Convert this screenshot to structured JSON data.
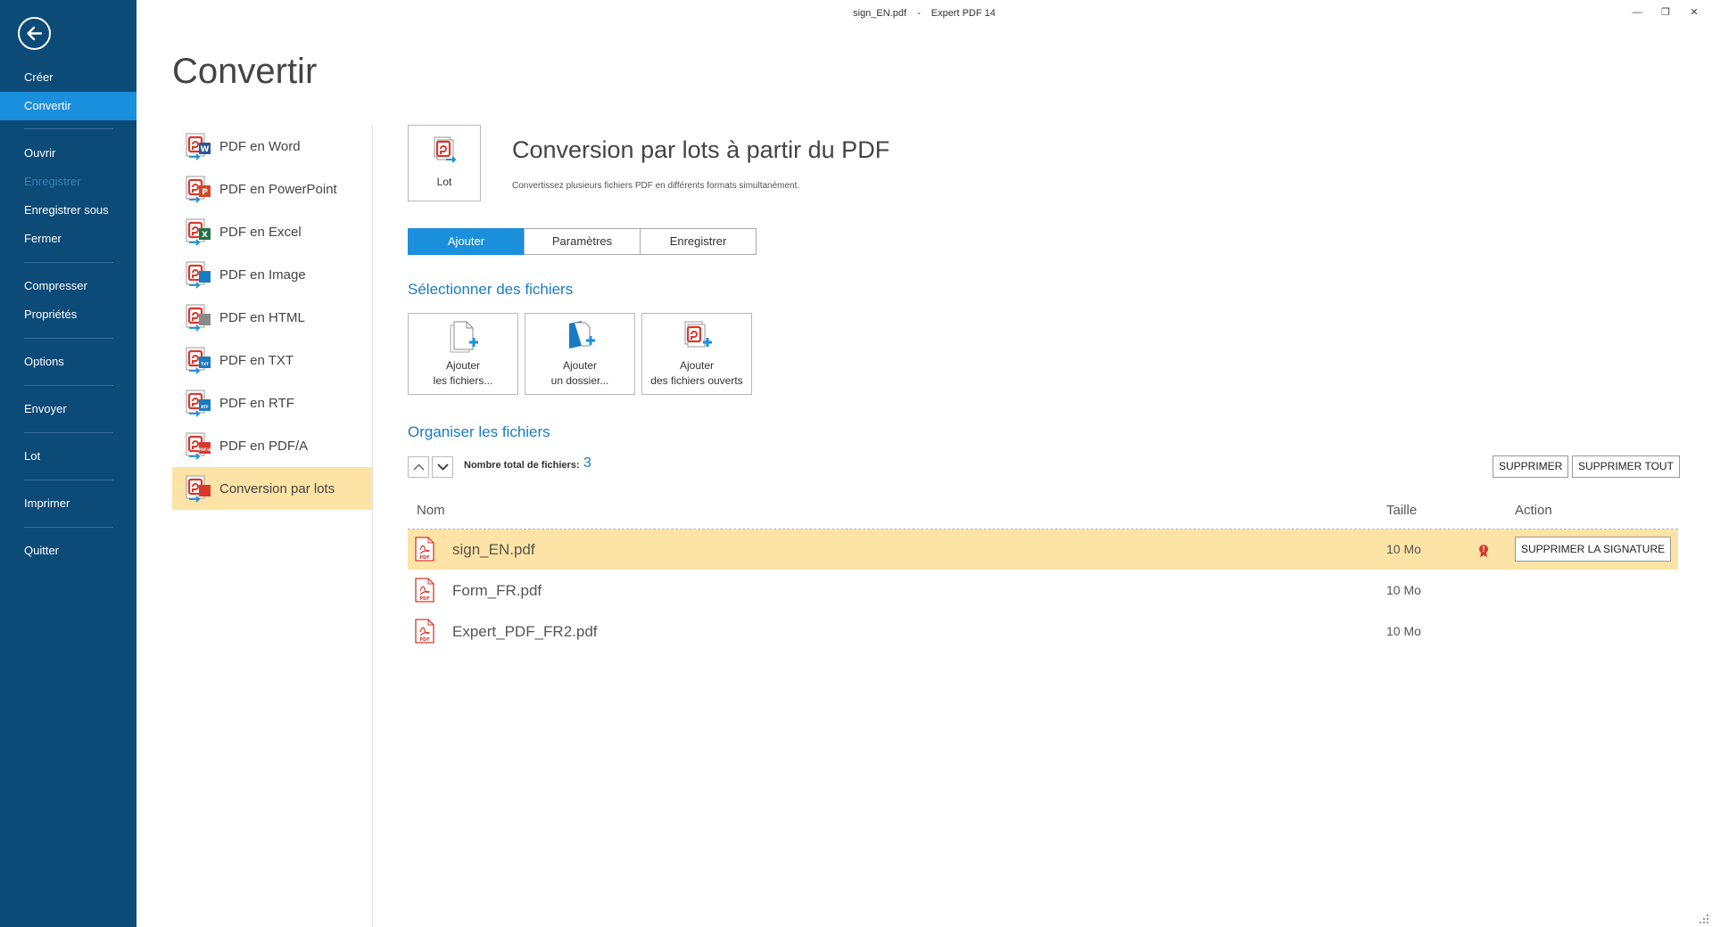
{
  "window": {
    "filename": "sign_EN.pdf",
    "separator": "-",
    "app_name": "Expert PDF 14",
    "minimize": "—",
    "restore": "❐",
    "close": "✕"
  },
  "sidebar": {
    "items": [
      {
        "label": "Créer"
      },
      {
        "label": "Convertir"
      },
      {
        "label": "Ouvrir"
      },
      {
        "label": "Enregistrer"
      },
      {
        "label": "Enregistrer sous"
      },
      {
        "label": "Fermer"
      },
      {
        "label": "Compresser"
      },
      {
        "label": "Propriétés"
      },
      {
        "label": "Options"
      },
      {
        "label": "Envoyer"
      },
      {
        "label": "Lot"
      },
      {
        "label": "Imprimer"
      },
      {
        "label": "Quitter"
      }
    ],
    "active": "Convertir",
    "active_color": "#1a8fdc",
    "background": "#0c4a78"
  },
  "page_title": "Convertir",
  "convert_options": [
    {
      "label": "PDF en Word",
      "badge": "W",
      "badge_color": "#2b579a"
    },
    {
      "label": "PDF en PowerPoint",
      "badge": "P",
      "badge_color": "#d24726"
    },
    {
      "label": "PDF en Excel",
      "badge": "X",
      "badge_color": "#217346"
    },
    {
      "label": "PDF en Image",
      "badge": "",
      "badge_color": "#1a7bc4"
    },
    {
      "label": "PDF en HTML",
      "badge": "",
      "badge_color": "#8a8a8a"
    },
    {
      "label": "PDF en TXT",
      "badge": "TXT",
      "badge_color": "#1a7bc4"
    },
    {
      "label": "PDF en RTF",
      "badge": "RTF",
      "badge_color": "#1a7bc4"
    },
    {
      "label": "PDF en PDF/A",
      "badge": "PDF/A",
      "badge_color": "#d9382b"
    },
    {
      "label": "Conversion par lots",
      "badge": "",
      "badge_color": "#d9382b"
    }
  ],
  "active_option": "Conversion par lots",
  "content": {
    "lot_label": "Lot",
    "title": "Conversion par lots à partir du PDF",
    "description": "Convertissez plusieurs fichiers PDF en différents formats simultanément.",
    "tabs": [
      {
        "label": "Ajouter"
      },
      {
        "label": "Paramètres"
      },
      {
        "label": "Enregistrer"
      }
    ],
    "active_tab": "Ajouter",
    "select_section": "Sélectionner des fichiers",
    "add_buttons": [
      {
        "label": "Ajouter\nles fichiers...",
        "icon": "add-files-icon"
      },
      {
        "label": "Ajouter\nun dossier...",
        "icon": "add-folder-icon"
      },
      {
        "label": "Ajouter\ndes fichiers ouverts",
        "icon": "add-open-files-icon"
      }
    ],
    "organize_section": "Organiser les fichiers",
    "total_label": "Nombre total de fichiers:",
    "total_count": "3",
    "delete_label": "SUPPRIMER",
    "delete_all_label": "SUPPRIMER TOUT",
    "columns": {
      "name": "Nom",
      "size": "Taille",
      "action": "Action"
    },
    "files": [
      {
        "name": "sign_EN.pdf",
        "size": "10 Mo",
        "signed": true,
        "action_label": "SUPPRIMER LA SIGNATURE"
      },
      {
        "name": "Form_FR.pdf",
        "size": "10 Mo",
        "signed": false,
        "action_label": ""
      },
      {
        "name": "Expert_PDF_FR2.pdf",
        "size": "10 Mo",
        "signed": false,
        "action_label": ""
      }
    ],
    "selected_row_color": "#fde3a5",
    "accent_color": "#1a7bc4"
  }
}
